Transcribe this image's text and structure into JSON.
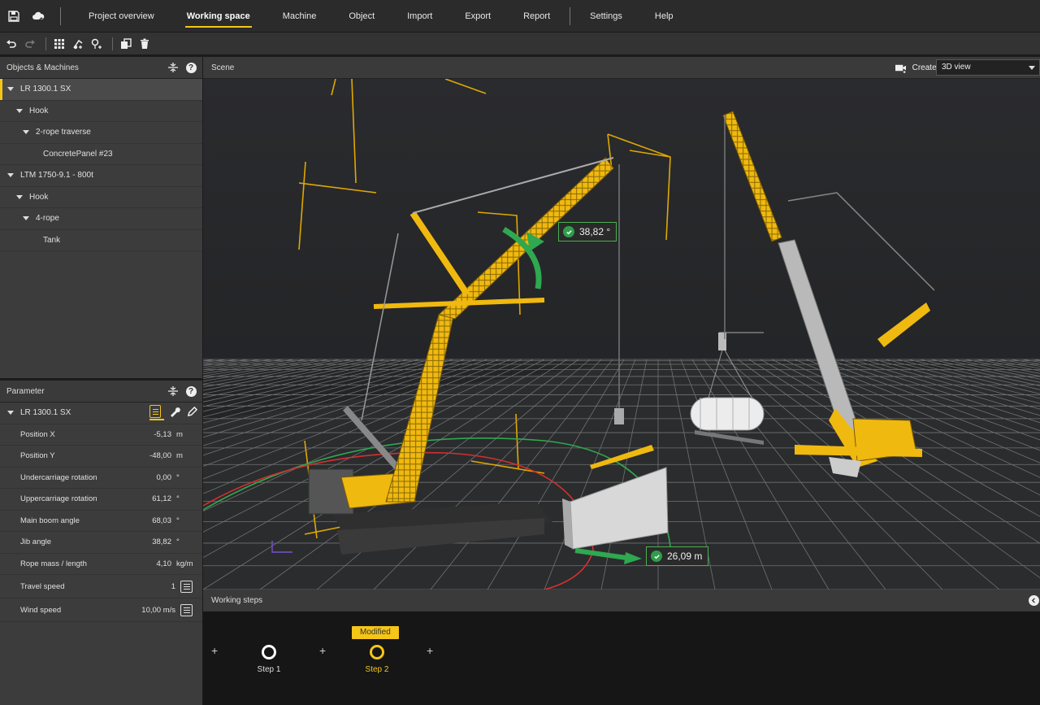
{
  "menu": {
    "items": [
      {
        "label": "Project overview"
      },
      {
        "label": "Working space",
        "active": true
      },
      {
        "label": "Machine"
      },
      {
        "label": "Object"
      },
      {
        "label": "Import"
      },
      {
        "label": "Export"
      },
      {
        "label": "Report"
      },
      {
        "label": "Settings"
      },
      {
        "label": "Help"
      }
    ]
  },
  "objects_panel": {
    "title": "Objects & Machines",
    "tree": [
      {
        "label": "LR 1300.1 SX",
        "level": 0,
        "caret": true,
        "selected": true
      },
      {
        "label": "Hook",
        "level": 1,
        "caret": true
      },
      {
        "label": "2-rope traverse",
        "level": 2,
        "caret": true
      },
      {
        "label": "ConcretePanel #23",
        "level": 3,
        "caret": false
      },
      {
        "label": "LTM 1750-9.1 - 800t",
        "level": 0,
        "caret": true
      },
      {
        "label": "Hook",
        "level": 1,
        "caret": true
      },
      {
        "label": "4-rope",
        "level": 2,
        "caret": true
      },
      {
        "label": "Tank",
        "level": 3,
        "caret": false
      }
    ]
  },
  "parameter_panel": {
    "title": "Parameter",
    "machine": "LR 1300.1 SX",
    "rows": [
      {
        "label": "Position X",
        "value": "-5,13",
        "unit": "m"
      },
      {
        "label": "Position Y",
        "value": "-48,00",
        "unit": "m"
      },
      {
        "label": "Undercarriage rotation",
        "value": "0,00",
        "unit": "°"
      },
      {
        "label": "Uppercarriage rotation",
        "value": "61,12",
        "unit": "°"
      },
      {
        "label": "Main boom angle",
        "value": "68,03",
        "unit": "°"
      },
      {
        "label": "Jib angle",
        "value": "38,82",
        "unit": "°"
      },
      {
        "label": "Rope mass / length",
        "value": "4,10",
        "unit": "kg/m"
      },
      {
        "label": "Travel speed",
        "value": "1",
        "unit": "",
        "doc": true
      },
      {
        "label": "Wind speed",
        "value": "10,00 m/s",
        "unit": "",
        "doc": true
      }
    ]
  },
  "scene": {
    "title": "Scene",
    "snapshot_label": "Create snapshot",
    "view_select": "3D view",
    "angle_label": "38,82 °",
    "distance_label": "26,09 m"
  },
  "working_steps": {
    "title": "Working steps",
    "steps": [
      {
        "label": "Step 1",
        "active": false
      },
      {
        "label": "Step 2",
        "active": true,
        "badge": "Modified"
      }
    ]
  },
  "colors": {
    "accent": "#f5c518",
    "ok": "#2e9e4a",
    "grid": "#8a8a8a"
  }
}
